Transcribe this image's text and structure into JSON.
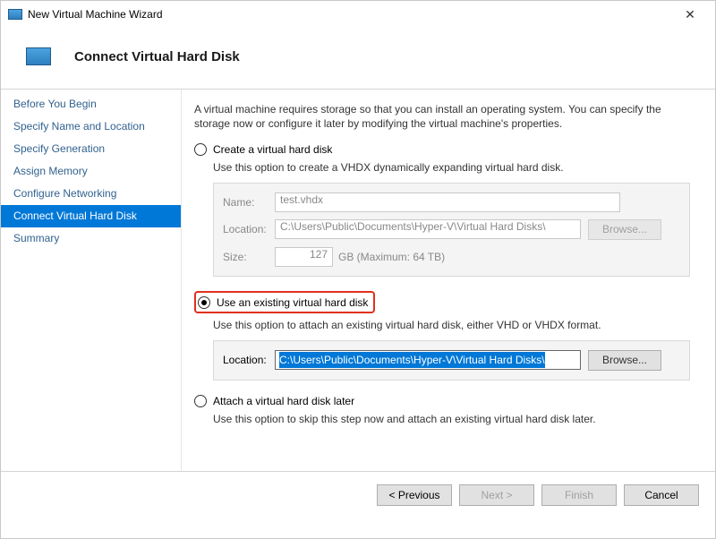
{
  "window": {
    "title": "New Virtual Machine Wizard"
  },
  "header": {
    "title": "Connect Virtual Hard Disk"
  },
  "sidebar": {
    "items": [
      "Before You Begin",
      "Specify Name and Location",
      "Specify Generation",
      "Assign Memory",
      "Configure Networking",
      "Connect Virtual Hard Disk",
      "Summary"
    ],
    "selectedIndex": 5
  },
  "content": {
    "intro": "A virtual machine requires storage so that you can install an operating system. You can specify the storage now or configure it later by modifying the virtual machine's properties.",
    "option_create": {
      "title": "Create a virtual hard disk",
      "desc": "Use this option to create a VHDX dynamically expanding virtual hard disk.",
      "name_label": "Name:",
      "name_value": "test.vhdx",
      "location_label": "Location:",
      "location_value": "C:\\Users\\Public\\Documents\\Hyper-V\\Virtual Hard Disks\\",
      "browse": "Browse...",
      "size_label": "Size:",
      "size_value": "127",
      "size_suffix": "GB (Maximum: 64 TB)"
    },
    "option_existing": {
      "title": "Use an existing virtual hard disk",
      "desc": "Use this option to attach an existing virtual hard disk, either VHD or VHDX format.",
      "location_label": "Location:",
      "location_value": "C:\\Users\\Public\\Documents\\Hyper-V\\Virtual Hard Disks\\",
      "browse": "Browse..."
    },
    "option_later": {
      "title": "Attach a virtual hard disk later",
      "desc": "Use this option to skip this step now and attach an existing virtual hard disk later."
    }
  },
  "footer": {
    "previous": "< Previous",
    "next": "Next >",
    "finish": "Finish",
    "cancel": "Cancel"
  }
}
